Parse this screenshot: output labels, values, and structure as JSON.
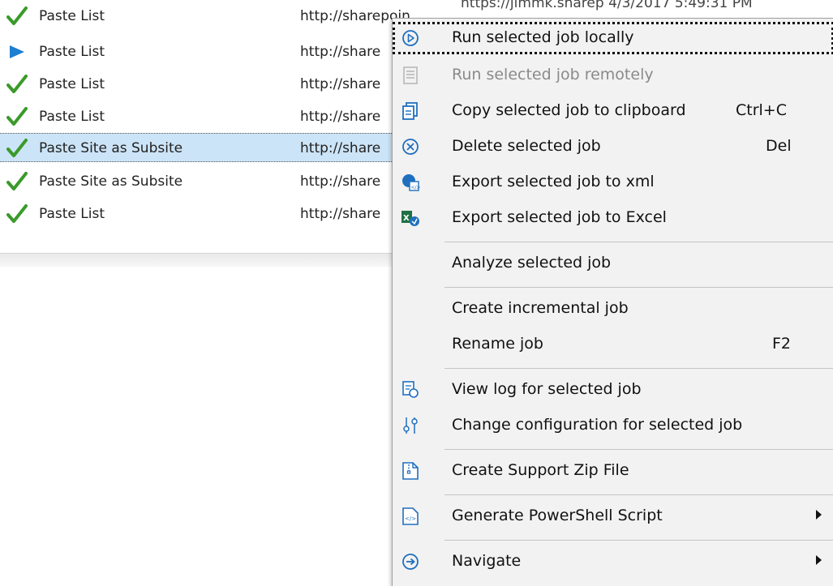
{
  "jobs": [
    {
      "name": "Paste List",
      "url": "http://sharepoin",
      "extra": "https://jimmk.sharep     4/3/2017 5:49:31 PM",
      "status_icon": "check-icon",
      "selected": false
    },
    {
      "name": "Paste List",
      "url": "http://share",
      "status_icon": "play-icon",
      "selected": false
    },
    {
      "name": "Paste List",
      "url": "http://share",
      "status_icon": "check-icon",
      "selected": false
    },
    {
      "name": "Paste List",
      "url": "http://share",
      "status_icon": "check-icon",
      "selected": false
    },
    {
      "name": "Paste Site as Subsite",
      "url": "http://share",
      "status_icon": "check-icon",
      "selected": true
    },
    {
      "name": "Paste Site as Subsite",
      "url": "http://share",
      "status_icon": "check-icon",
      "selected": false
    },
    {
      "name": "Paste List",
      "url": "http://share",
      "status_icon": "check-icon",
      "selected": false
    }
  ],
  "menu": {
    "run_local": "Run selected job locally",
    "run_remote": "Run selected job remotely",
    "copy": "Copy selected job to clipboard",
    "copy_shortcut": "Ctrl+C",
    "delete": "Delete selected job",
    "delete_shortcut": "Del",
    "export_xml": "Export selected job to xml",
    "export_excel": "Export selected job to Excel",
    "analyze": "Analyze selected job",
    "incremental": "Create incremental job",
    "rename": "Rename job",
    "rename_shortcut": "F2",
    "view_log": "View log for selected job",
    "change_config": "Change configuration for selected job",
    "support_zip": "Create Support Zip File",
    "powershell": "Generate PowerShell Script",
    "navigate": "Navigate"
  },
  "colors": {
    "check_green": "#3a9a2a",
    "play_blue": "#1e7fd0",
    "selection_bg": "#cce4f7",
    "menu_bg": "#f2f2f2",
    "icon_blue": "#1f6fbf"
  }
}
